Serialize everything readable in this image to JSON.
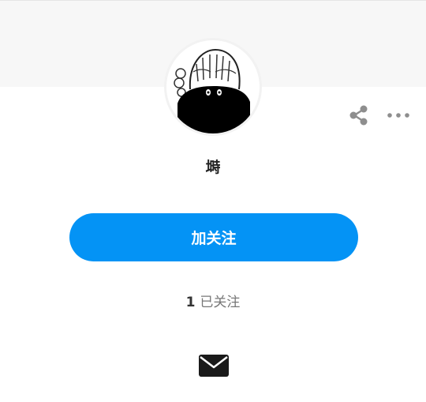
{
  "profile": {
    "username": "塒",
    "follow_button_label": "加关注",
    "following_count": "1",
    "following_label": "已关注"
  },
  "icons": {
    "avatar": "anime-avatar-image",
    "share": "share-icon",
    "more": "more-options-icon",
    "message": "mail-icon"
  },
  "colors": {
    "accent": "#0493f5",
    "icon_gray": "#8e8e8e",
    "text_dark": "#222222",
    "text_muted": "#777777"
  }
}
